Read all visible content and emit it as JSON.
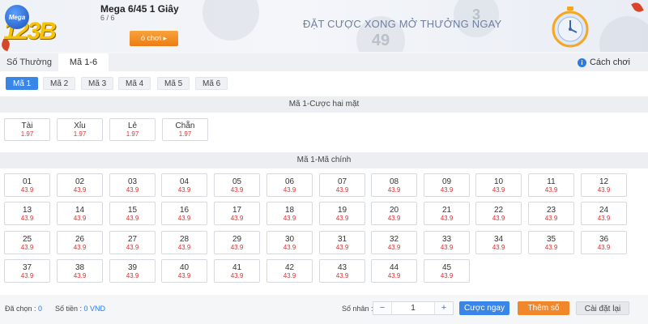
{
  "header": {
    "logo_badge": "Mega",
    "logo_text": "123B",
    "game_title": "Mega 6/45 1 Giây",
    "game_sub": "6 / 6",
    "play_label": "ó chơi ▸",
    "slogan": "ĐẶT CƯỢC XONG MỞ THƯỞNG NGAY",
    "bg_numbers": [
      "49",
      "3"
    ]
  },
  "tabs": [
    {
      "label": "Số Thường",
      "active": false
    },
    {
      "label": "Mã 1-6",
      "active": true
    }
  ],
  "help": {
    "icon": "i",
    "label": "Cách chơi"
  },
  "sub_tabs": [
    "Mã 1",
    "Mã 2",
    "Mã 3",
    "Mã 4",
    "Mã 5",
    "Mã 6"
  ],
  "section1": {
    "title": "Mã 1-Cược hai mặt",
    "bets": [
      {
        "label": "Tài",
        "odd": "1.97"
      },
      {
        "label": "Xỉu",
        "odd": "1.97"
      },
      {
        "label": "Lẻ",
        "odd": "1.97"
      },
      {
        "label": "Chẵn",
        "odd": "1.97"
      }
    ]
  },
  "section2": {
    "title": "Mã 1-Mã chính",
    "numbers": [
      "01",
      "02",
      "03",
      "04",
      "05",
      "06",
      "07",
      "08",
      "09",
      "10",
      "11",
      "12",
      "13",
      "14",
      "15",
      "16",
      "17",
      "18",
      "19",
      "20",
      "21",
      "22",
      "23",
      "24",
      "25",
      "26",
      "27",
      "28",
      "29",
      "30",
      "31",
      "32",
      "33",
      "34",
      "35",
      "36",
      "37",
      "38",
      "39",
      "40",
      "41",
      "42",
      "43",
      "44",
      "45"
    ],
    "odd": "43.9"
  },
  "footer": {
    "selected_label": "Đã chọn :",
    "selected_value": "0",
    "amount_label": "Số tiền :",
    "amount_value": "0 VND",
    "multiplier_label": "Số nhân :",
    "minus": "−",
    "quantity": "1",
    "plus": "+",
    "bet_now": "Cược ngay",
    "add_number": "Thêm số",
    "reset": "Cài đặt lại"
  },
  "colors": {
    "accent_blue": "#3a86e8",
    "orange": "#ee7c12",
    "odd_red": "#dd3333"
  }
}
